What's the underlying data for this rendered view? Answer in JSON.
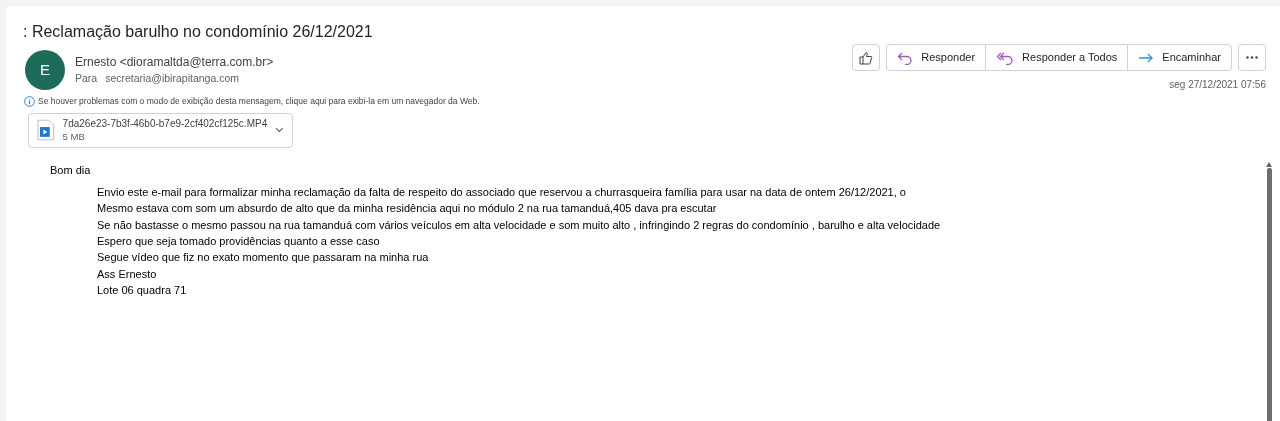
{
  "subject": ": Reclamação barulho no condomínio 26/12/2021",
  "sender": {
    "initial": "E",
    "from": "Ernesto <dioramaltda@terra.com.br>",
    "to_label": "Para",
    "to": "secretaria@ibirapitanga.com"
  },
  "actions": [
    {
      "kind": "reply",
      "label": "Responder"
    },
    {
      "kind": "reply_all",
      "label": "Responder a Todos"
    },
    {
      "kind": "forward",
      "label": "Encaminhar"
    }
  ],
  "date": "seg 27/12/2021 07:56",
  "info": "Se houver problemas com o modo de exibição desta mensagem, clique aqui para exibi-la em um navegador da Web.",
  "attachment": {
    "name": "7da26e23-7b3f-46b0-b7e9-2cf402cf125c.MP4",
    "size": "5 MB"
  },
  "greeting": "Bom dia",
  "body": [
    "Envio este e-mail para formalizar minha reclamação da falta de respeito do associado que reservou a churrasqueira família para usar na data de ontem 26/12/2021, o",
    "Mesmo estava com som um absurdo de alto que da minha residência aqui no módulo 2 na rua tamanduá,405 dava pra escutar",
    "Se não bastasse o mesmo passou na rua tamanduá com vários veículos em alta velocidade e som muito alto , infringindo 2 regras do condomínio , barulho e alta velocidade",
    "Espero que seja tomado providências quanto a esse caso",
    "Segue vídeo que fiz no exato momento que passaram na minha rua",
    "Ass Ernesto",
    "Lote 06 quadra 71"
  ]
}
